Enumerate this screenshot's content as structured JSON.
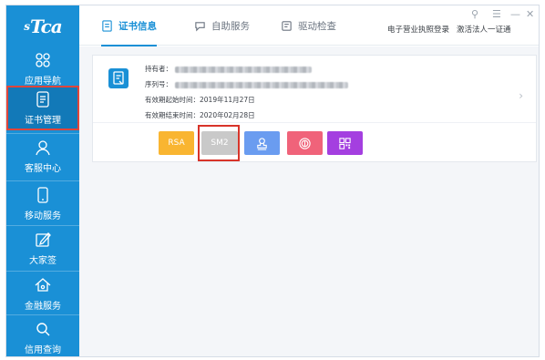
{
  "logo": {
    "sup": "s",
    "text": "Tca"
  },
  "sidebar": {
    "items": [
      {
        "label": "应用导航",
        "icon": "grid-icon"
      },
      {
        "label": "证书管理",
        "icon": "certificate-doc-icon"
      },
      {
        "label": "客服中心",
        "icon": "user-icon"
      },
      {
        "label": "移动服务",
        "icon": "mobile-phone-icon"
      },
      {
        "label": "大家签",
        "icon": "edit-sign-icon"
      },
      {
        "label": "金融服务",
        "icon": "home-finance-icon"
      },
      {
        "label": "信用查询",
        "icon": "search-icon"
      }
    ],
    "active_index": 1
  },
  "header": {
    "tabs": [
      {
        "label": "证书信息",
        "icon": "certificate-icon"
      },
      {
        "label": "自助服务",
        "icon": "chat-bubble-icon"
      },
      {
        "label": "驱动检查",
        "icon": "driver-check-icon"
      }
    ],
    "links": [
      "电子营业执照登录",
      "激活法人一证通"
    ],
    "window_controls": [
      "⚲",
      "☰",
      "—",
      "✕"
    ]
  },
  "certificate": {
    "holder_label": "持有者：",
    "serial_label": "序列号：",
    "valid_from": "有效期起始时间：2019年11月27日",
    "valid_to": "有效期结束时间：2020年02月28日"
  },
  "algorithms": [
    {
      "label": "RSA"
    },
    {
      "label": "SM2"
    }
  ],
  "colors": {
    "sidebar": "#1a90d6",
    "rsa": "#f9b531",
    "sm2": "#c9c9c9",
    "seal": "#6a9cf0",
    "stamp": "#f0637a",
    "qr": "#a43fe0",
    "highlight": "#d8342a"
  }
}
